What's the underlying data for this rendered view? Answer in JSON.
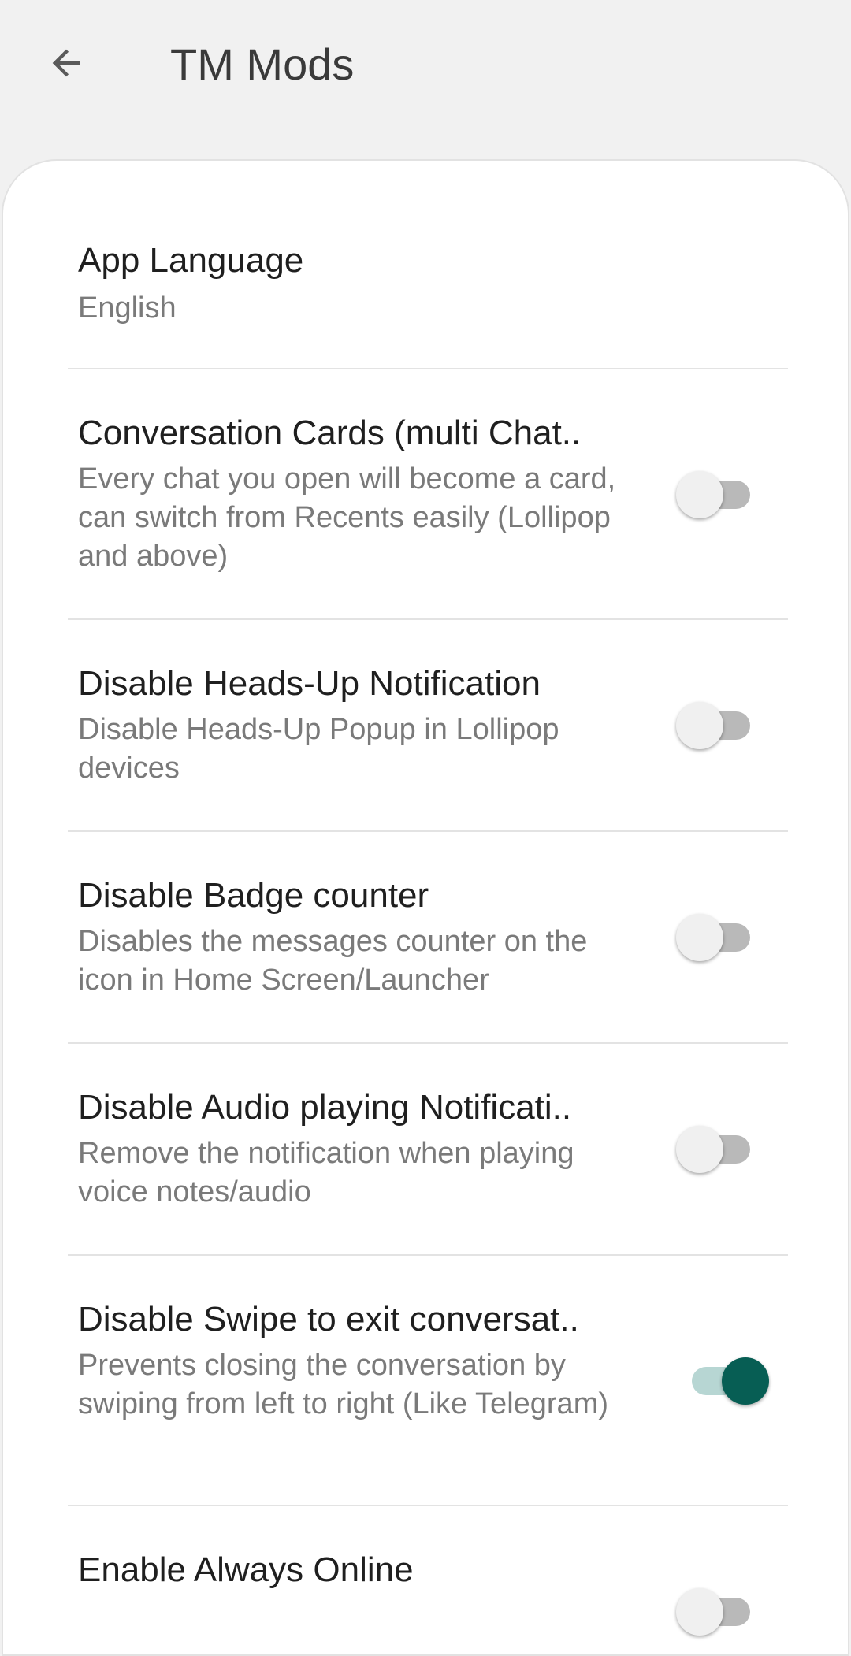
{
  "header": {
    "title": "TM Mods",
    "back_icon": "arrow-back-icon"
  },
  "colors": {
    "accent": "#075e54",
    "accent_track": "#b7d6d3",
    "background": "#f1f1f1"
  },
  "prefs": [
    {
      "title": "App Language",
      "summary": "English",
      "has_switch": false
    },
    {
      "title": "Conversation Cards (multi Chat..",
      "summary": "Every chat you open will become a card, can switch from Recents easily (Lollipop and above)",
      "has_switch": true,
      "checked": false
    },
    {
      "title": "Disable Heads-Up Notification",
      "summary": "Disable Heads-Up Popup in Lollipop devices",
      "has_switch": true,
      "checked": false
    },
    {
      "title": "Disable Badge counter",
      "summary": "Disables the messages counter on the icon in Home Screen/Launcher",
      "has_switch": true,
      "checked": false
    },
    {
      "title": "Disable Audio playing Notificati..",
      "summary": "Remove the notification when playing voice notes/audio",
      "has_switch": true,
      "checked": false
    },
    {
      "title": "Disable Swipe to exit conversat..",
      "summary": "Prevents closing the conversation by swiping from left to right (Like Telegram)",
      "has_switch": true,
      "checked": true
    },
    {
      "title": "Enable Always Online",
      "summary": "",
      "has_switch": true,
      "checked": false
    }
  ]
}
